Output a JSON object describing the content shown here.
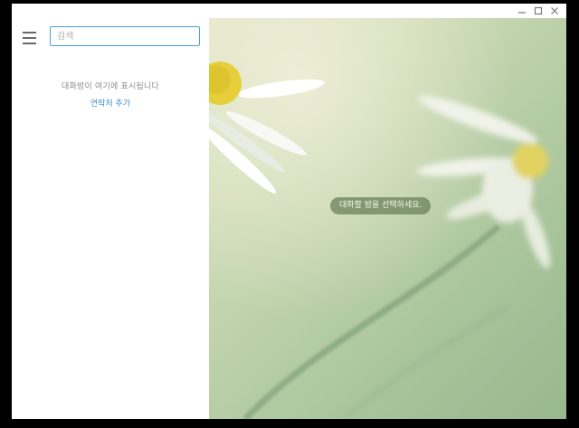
{
  "window": {
    "controls": {
      "minimize_icon": "minimize-icon",
      "maximize_icon": "maximize-icon",
      "close_icon": "close-icon"
    }
  },
  "sidebar": {
    "menu_icon": "hamburger-menu-icon",
    "search": {
      "placeholder": "검색",
      "value": ""
    },
    "empty_message": "대화방이 여기에 표시됩니다",
    "add_contact_label": "연락처 추가"
  },
  "main": {
    "prompt": "대화할 방을 선택하세요."
  },
  "colors": {
    "accent": "#3d8fd0",
    "search_border": "#4a9fd8",
    "pill_bg": "#768c64"
  }
}
